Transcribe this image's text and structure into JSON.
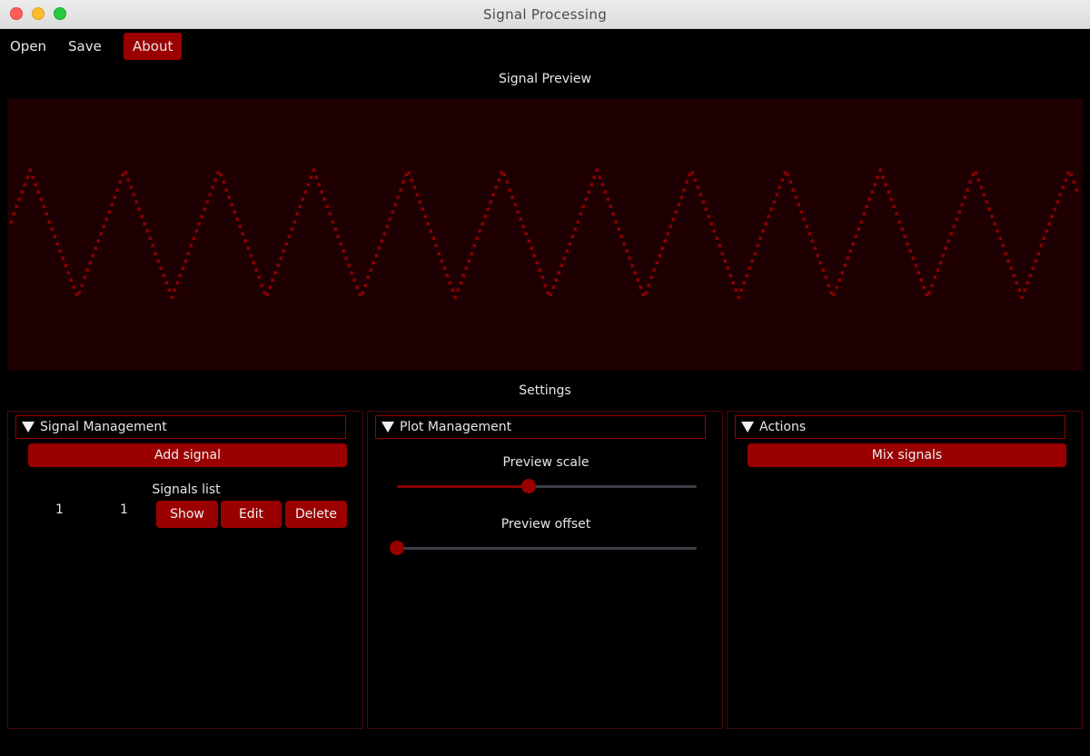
{
  "window": {
    "title": "Signal Processing"
  },
  "menu": {
    "open": "Open",
    "save": "Save",
    "about": "About"
  },
  "plot": {
    "title": "Signal Preview",
    "color": "#8b0000",
    "background": "#1f0002"
  },
  "settings": {
    "title": "Settings",
    "signal_management": {
      "header": "Signal Management",
      "add_button": "Add signal",
      "list_title": "Signals list",
      "rows": [
        {
          "col1": "1",
          "col2": "1",
          "show": "Show",
          "edit": "Edit",
          "delete": "Delete"
        }
      ]
    },
    "plot_management": {
      "header": "Plot Management",
      "scale_label": "Preview scale",
      "scale_value": 0.44,
      "offset_label": "Preview offset",
      "offset_value": 0.0
    },
    "actions": {
      "header": "Actions",
      "mix_button": "Mix signals"
    }
  },
  "colors": {
    "accent": "#9a0000",
    "panel_border": "#4a0808"
  }
}
